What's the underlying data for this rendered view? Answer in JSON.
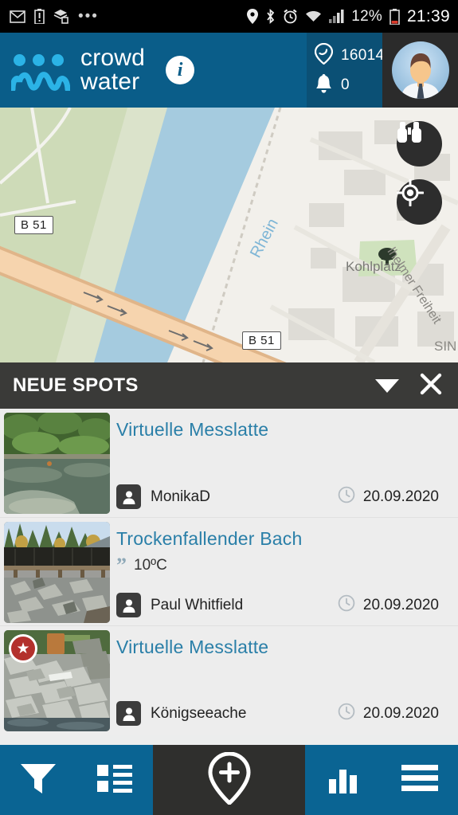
{
  "statusbar": {
    "left_icons": [
      "gmail-icon",
      "battery-alert-icon",
      "layers-icon",
      "more-dots-icon"
    ],
    "right_icons": [
      "location-icon",
      "bluetooth-icon",
      "alarm-icon",
      "wifi-icon",
      "signal-icon"
    ],
    "battery_percent": "12%",
    "battery_icon": "battery-low-icon",
    "clock": "21:39"
  },
  "header": {
    "brand_line1": "crowd",
    "brand_line2": "water",
    "logo_icon": "crowdwater-people-wave-logo",
    "info_label": "i",
    "spot_count": "16014",
    "spot_icon": "location-marker-icon",
    "notification_count": "0",
    "notification_icon": "bell-icon",
    "avatar_icon": "user-avatar",
    "bg_color": "#0a5d89",
    "stats_bg_color": "#0b5075",
    "avatar_bg_color": "#2b2b2b",
    "logo_accent": "#2bb3e6"
  },
  "map": {
    "river_label": "Rhein",
    "place_label": "Kohlplatz",
    "street_label": "lhelmer Freiheit",
    "street_label_2": "SIN",
    "road_shield_left": "B 51",
    "road_shield_right": "B 51",
    "tree_icon": "tree-icon",
    "binoculars_icon": "binoculars-icon",
    "locate_icon": "crosshair-locate-icon",
    "water_color": "#a5cbdf",
    "road_color": "#f2c99a",
    "green_color": "#cedbb8"
  },
  "section": {
    "title": "NEUE SPOTS",
    "collapse_icon": "chevron-down-icon",
    "close_icon": "close-icon",
    "bg_color": "#3a3a38"
  },
  "spots": [
    {
      "title": "Virtuelle Messlatte",
      "quote": "",
      "user": "MonikaD",
      "date": "20.09.2020",
      "thumb_icon": "stream-photo-thumbnail",
      "starred": false
    },
    {
      "title": "Trockenfallender Bach",
      "quote": "10ºC",
      "user": "Paul Whitfield",
      "date": "20.09.2020",
      "thumb_icon": "dry-creek-photo-thumbnail",
      "starred": false
    },
    {
      "title": "Virtuelle Messlatte",
      "quote": "",
      "user": "Königseeache",
      "date": "20.09.2020",
      "thumb_icon": "rocky-shore-photo-thumbnail",
      "starred": true,
      "star_icon": "star-badge-icon"
    }
  ],
  "bottomnav": {
    "items": [
      {
        "icon": "filter-funnel-icon",
        "name": "filter"
      },
      {
        "icon": "list-view-icon",
        "name": "list"
      },
      {
        "icon": "add-spot-pin-icon",
        "name": "add-spot"
      },
      {
        "icon": "bar-chart-icon",
        "name": "statistics"
      },
      {
        "icon": "hamburger-menu-icon",
        "name": "menu"
      }
    ],
    "bg_color": "#0a6493",
    "center_bg_color": "#2f2f2d"
  }
}
